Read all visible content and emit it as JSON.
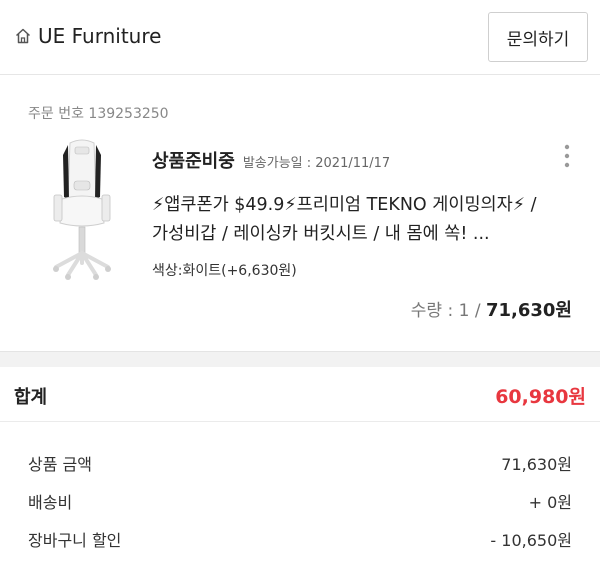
{
  "header": {
    "store_name": "UE Furniture",
    "home_icon": "home-icon",
    "inquiry_label": "문의하기"
  },
  "order": {
    "order_number": "주문 번호 139253250",
    "status": "상품준비중",
    "ship_date": "발송가능일 : 2021/11/17",
    "product_title": "⚡앱쿠폰가 $49.9⚡프리미엄 TEKNO 게이밍의자⚡ / 가성비갑 / 레이싱카 버킷시트 / 내 몸에 쏙! ...",
    "option": "색상:화이트(+6,630원)",
    "quantity": "수량 : 1",
    "separator": "/",
    "price": "71,630원",
    "thumbnail_icon": "gaming-chair-image",
    "more_icon": "more-vertical-icon"
  },
  "summary": {
    "total_label": "합계",
    "total_value": "60,980원",
    "rows": [
      {
        "label": "상품 금액",
        "value": "71,630원"
      },
      {
        "label": "배송비",
        "value": "+ 0원"
      },
      {
        "label": "장바구니 할인",
        "value": "- 10,650원"
      }
    ]
  },
  "colors": {
    "total_accent": "#e8373f",
    "background": "#f2f2f2"
  }
}
